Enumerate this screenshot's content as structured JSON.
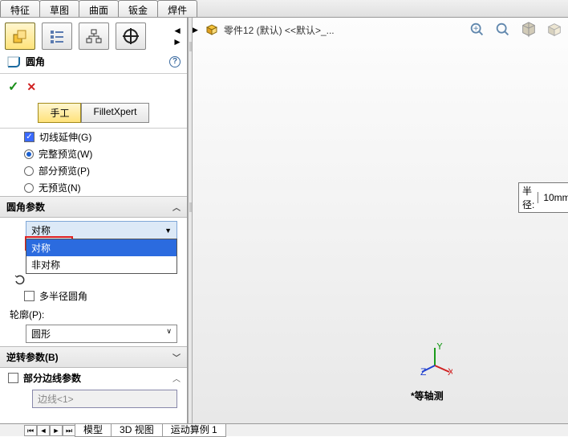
{
  "top_tabs": [
    "特征",
    "草图",
    "曲面",
    "钣金",
    "焊件"
  ],
  "doc_title": "零件12 (默认) <<默认>_...",
  "feature": {
    "title": "圆角",
    "ok": "✓",
    "cancel": "✕"
  },
  "mode": {
    "manual": "手工",
    "xpert": "FilletXpert"
  },
  "options": {
    "tangent": "切线延伸(G)",
    "full_preview": "完整预览(W)",
    "partial_preview": "部分预览(P)",
    "no_preview": "无预览(N)"
  },
  "sections": {
    "fillet_params": "圆角参数",
    "reverse_params": "逆转参数(B)",
    "partial_edge": "部分边线参数"
  },
  "dd": {
    "selected": "对称",
    "opts": [
      "对称",
      "非对称"
    ]
  },
  "multi_radius": "多半径圆角",
  "profile_label": "轮廓(P):",
  "profile_value": "圆形",
  "edge_placeholder": "边线<1>",
  "callout": {
    "label": "半径:",
    "value": "10mm"
  },
  "orientation": "*等轴测",
  "bottom_tabs": [
    "模型",
    "3D 视图",
    "运动算例 1"
  ],
  "vp_icon_names": [
    "zoom-fit-icon",
    "zoom-area-icon",
    "section-view-icon",
    "view-orient-icon"
  ]
}
